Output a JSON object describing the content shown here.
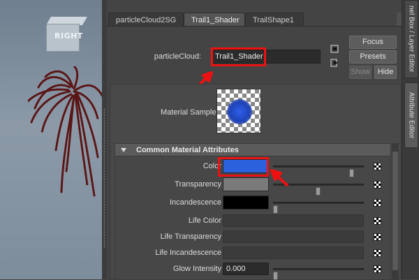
{
  "viewport": {
    "viewcube_label": "RIGHT"
  },
  "tabs": [
    {
      "label": "particleCloud2SG"
    },
    {
      "label": "Trail1_Shader"
    },
    {
      "label": "TrailShape1"
    }
  ],
  "node": {
    "label": "particleCloud:",
    "value": "Trail1_Shader"
  },
  "buttons": {
    "focus": "Focus",
    "presets": "Presets",
    "show": "Show",
    "hide": "Hide"
  },
  "material_sample_label": "Material Sample",
  "section": {
    "title": "Common Material Attributes",
    "rows": [
      {
        "label": "Color",
        "color": "#2a62e0",
        "slider": 0.9
      },
      {
        "label": "Transparency",
        "color": "#7a7a7a",
        "slider": 0.5
      },
      {
        "label": "Incandescence",
        "color": "#000000",
        "slider": 0.0
      },
      {
        "label": "Life Color"
      },
      {
        "label": "Life Transparency"
      },
      {
        "label": "Life Incandescence"
      },
      {
        "label": "Glow Intensity",
        "value": "0.000",
        "slider": 0.0
      }
    ]
  },
  "right_rail": {
    "tab_top": "nel Box / Layer Editor",
    "tab_active": "Attribute Editor"
  },
  "colors": {
    "highlight": "#e11111",
    "accent_blue": "#2a62e0"
  }
}
